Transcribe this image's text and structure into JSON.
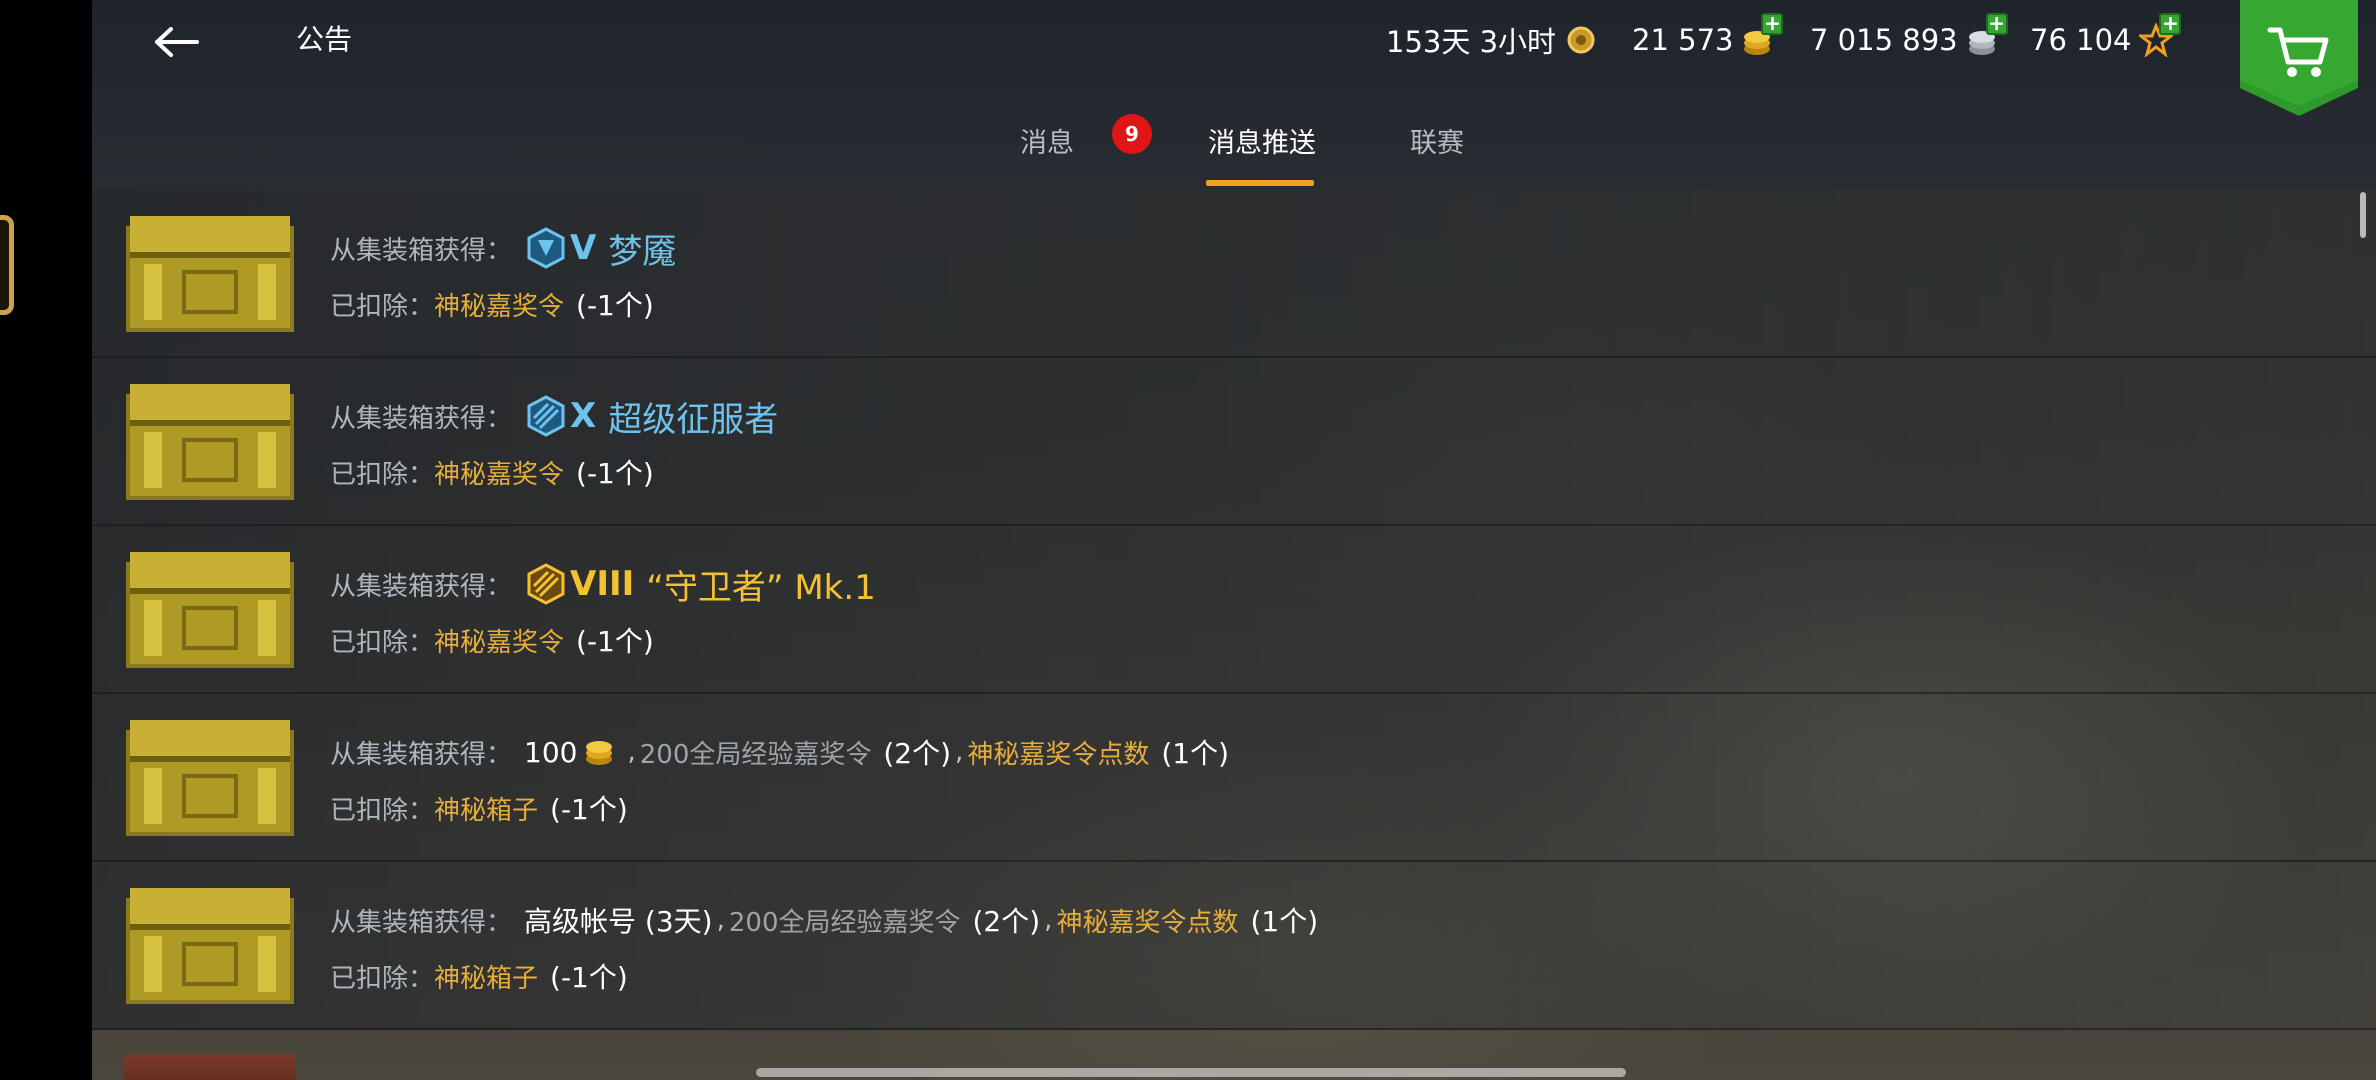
{
  "header": {
    "title": "公告",
    "back_icon": "arrow-left-icon",
    "timer": "153天 3小时",
    "gold": "21 573",
    "silver": "7 015 893",
    "free_xp": "76 104",
    "shop_icon": "shopping-cart-icon"
  },
  "tabs": [
    {
      "label": "消息",
      "badge": "9"
    },
    {
      "label": "消息推送",
      "active": true
    },
    {
      "label": "联赛"
    }
  ],
  "rows": [
    {
      "label": "从集装箱获得：",
      "tier": "V",
      "tank": "梦魇",
      "tier_color": "#6ec2ee",
      "deduct_label": "已扣除：",
      "deduct_item": "神秘嘉奖令",
      "deduct_qty": "(-1个)"
    },
    {
      "label": "从集装箱获得：",
      "tier": "X",
      "tank": "超级征服者",
      "tier_color": "#6ec2ee",
      "deduct_label": "已扣除：",
      "deduct_item": "神秘嘉奖令",
      "deduct_qty": "(-1个)"
    },
    {
      "label": "从集装箱获得：",
      "tier": "VIII",
      "tank": "“守卫者” Mk.1",
      "tier_color": "#f2c230",
      "deduct_label": "已扣除：",
      "deduct_item": "神秘嘉奖令",
      "deduct_qty": "(-1个)"
    },
    {
      "label": "从集装箱获得：",
      "gold_amount": "100",
      "comma1": ",",
      "item1": "200全局经验嘉奖令",
      "item1_qty": "(2个)",
      "comma2": ",",
      "item2": "神秘嘉奖令点数",
      "item2_qty": "(1个)",
      "deduct_label": "已扣除：",
      "deduct_item": "神秘箱子",
      "deduct_qty": "(-1个)"
    },
    {
      "label": "从集装箱获得：",
      "premium": "高级帐号 (3天)",
      "comma1": ",",
      "item1": "200全局经验嘉奖令",
      "item1_qty": "(2个)",
      "comma2": ",",
      "item2": "神秘嘉奖令点数",
      "item2_qty": "(1个)",
      "deduct_label": "已扣除：",
      "deduct_item": "神秘箱子",
      "deduct_qty": "(-1个)"
    }
  ],
  "colors": {
    "accent": "#f0a020",
    "gold_text": "#e6ad3a",
    "tier_blue": "#6ec2ee",
    "tier_gold": "#f2c230",
    "badge_red": "#e01515",
    "shop_green": "#2f9a2c"
  }
}
